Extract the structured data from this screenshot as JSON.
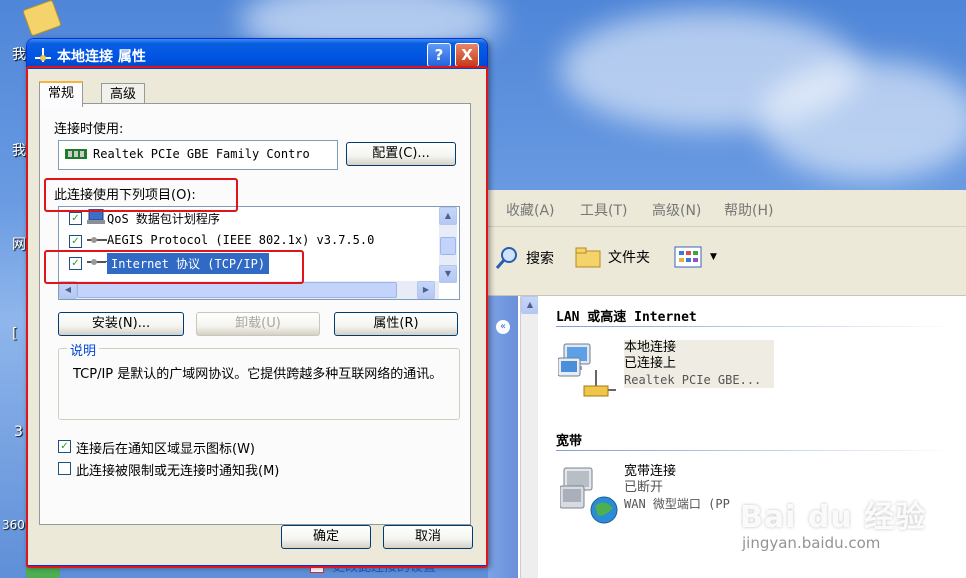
{
  "desktop": {
    "icon_labels": [
      "我",
      "我",
      "网",
      "[",
      "3",
      "360"
    ]
  },
  "explorer": {
    "menu": [
      "收藏(A)",
      "工具(T)",
      "高级(N)",
      "帮助(H)"
    ],
    "toolbar": {
      "search": "搜索",
      "folders": "文件夹"
    },
    "groups": [
      {
        "title": "LAN 或高速 Internet",
        "connection": {
          "name": "本地连接",
          "status": "已连接上",
          "device": "Realtek PCIe GBE..."
        }
      },
      {
        "title": "宽带",
        "connection": {
          "name": "宽带连接",
          "status": "已断开",
          "device": "WAN 微型端口 (PP"
        }
      }
    ],
    "task_item": "更改此连接的设置"
  },
  "dialog": {
    "title": "本地连接 属性",
    "help_btn": "?",
    "close_btn": "X",
    "tabs": [
      "常规",
      "高级"
    ],
    "connect_using_label": "连接时使用:",
    "adapter_name": "Realtek PCIe GBE Family Contro",
    "configure_btn": "配置(C)...",
    "items_label": "此连接使用下列项目(O):",
    "items": [
      {
        "label": "QoS 数据包计划程序",
        "checked": true
      },
      {
        "label": "AEGIS Protocol (IEEE 802.1x) v3.7.5.0",
        "checked": true
      },
      {
        "label": "Internet 协议 (TCP/IP)",
        "checked": true
      }
    ],
    "install_btn": "安装(N)...",
    "uninstall_btn": "卸载(U)",
    "properties_btn": "属性(R)",
    "description_title": "说明",
    "description_text": "TCP/IP 是默认的广域网协议。它提供跨越多种互联网络的通讯。",
    "notify_icon_label": "连接后在通知区域显示图标(W)",
    "notify_icon_checked": true,
    "notify_limited_label": "此连接被限制或无连接时通知我(M)",
    "notify_limited_checked": false,
    "ok_btn": "确定",
    "cancel_btn": "取消"
  },
  "watermark": {
    "brand": "Bai du 经验",
    "url": "jingyan.baidu.com"
  }
}
